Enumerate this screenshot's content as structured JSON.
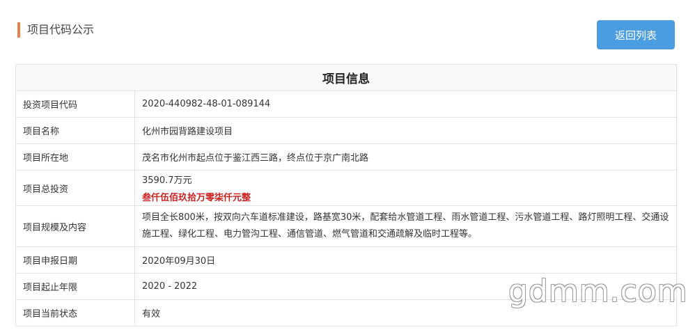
{
  "header": {
    "title": "项目代码公示"
  },
  "back_button": {
    "label": "返回列表"
  },
  "table": {
    "heading": "项目信息",
    "rows": [
      {
        "label": "投资项目代码",
        "value": "2020-440982-48-01-089144"
      },
      {
        "label": "项目名称",
        "value": "化州市园背路建设项目"
      },
      {
        "label": "项目所在地",
        "value": "茂名市化州市起点位于鉴江西三路，终点位于京广南北路"
      },
      {
        "label": "项目总投资",
        "value": "3590.7万元",
        "value_cn": "叁仟伍佰玖拾万零柒仟元整"
      },
      {
        "label": "项目规模及内容",
        "value": "项目全长800米，按双向六车道标准建设，路基宽30米，配套给水管道工程、雨水管道工程、污水管道工程、路灯照明工程、交通设施工程、绿化工程、电力管沟工程、通信管道、燃气管道和交通疏解及临时工程等。"
      },
      {
        "label": "项目申报日期",
        "value": "2020年09月30日"
      },
      {
        "label": "项目起止年限",
        "value": "2020 - 2022"
      },
      {
        "label": "项目当前状态",
        "value": "有效"
      }
    ]
  },
  "watermark": "gdmm.com",
  "colors": {
    "accent_bar": "#e8834f",
    "button": "#4a9de0",
    "highlight": "#cc1f1f"
  }
}
